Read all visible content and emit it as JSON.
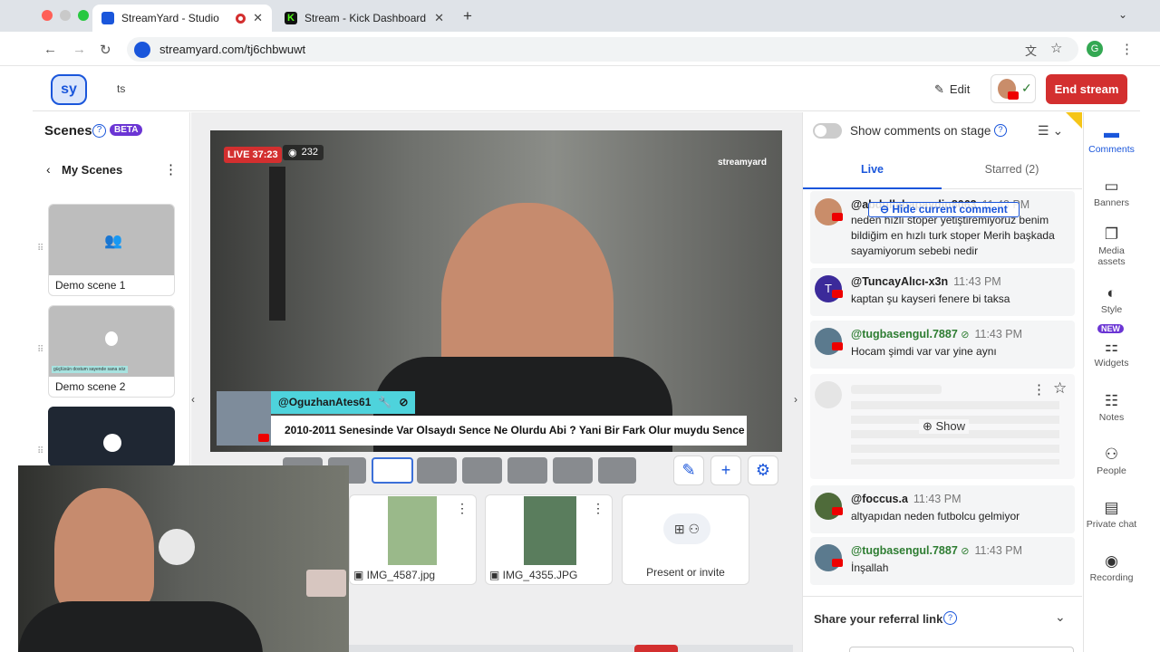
{
  "browser": {
    "tabs": [
      {
        "title": "StreamYard - Studio",
        "fav_color": "#1a56db"
      },
      {
        "title": "Stream - Kick Dashboard",
        "fav_color": "#53fc18"
      }
    ],
    "new_tab": "+",
    "url": "streamyard.com/tj6chbwuwt",
    "profile": "G"
  },
  "header": {
    "logo": "sy",
    "title": "ts",
    "edit": "Edit",
    "end_stream": "End stream"
  },
  "scenes": {
    "title": "Scenes",
    "beta": "BETA",
    "my_scenes": "My Scenes",
    "items": [
      {
        "label": "Demo scene 1"
      },
      {
        "label": "Demo scene 2",
        "ticker": "güçlüsün dostum sayende sana söz"
      }
    ]
  },
  "stage": {
    "live_badge": "LIVE 37:23",
    "viewers": "232",
    "watermark": "streamyard",
    "banner_user": "@OguzhanAtes61",
    "banner_text": "2010-2011 Senesinde Var Olsaydı Sence Ne Olurdu Abi ? Yani Bir Fark Olur muydu Sence ?"
  },
  "media": [
    {
      "name": "IMG_4587.jpg"
    },
    {
      "name": "IMG_4355.JPG"
    },
    {
      "name": "Present or invite"
    }
  ],
  "comments_panel": {
    "toggle_label": "Show comments on stage",
    "tab_live": "Live",
    "tab_starred": "Starred (2)",
    "hide_comment": "Hide current comment",
    "show": "Show",
    "comments": [
      {
        "name": "@abdullahapaydin8063",
        "time": "11:43 PM",
        "text": "neden hızlı stoper yetiştiremiyoruz benim bildiğim en hızlı turk stoper Merih başkada sayamiyorum sebebi nedir",
        "color": "#1f1f1f"
      },
      {
        "name": "@TuncayAlıcı-x3n",
        "time": "11:43 PM",
        "text": "kaptan şu kayseri fenere bi taksa",
        "color": "#1f1f1f"
      },
      {
        "name": "@tugbasengul.7887",
        "time": "11:43 PM",
        "text": "Hocam şimdi var var yine aynı",
        "color": "#2e7d32"
      },
      {
        "name": "@foccus.a",
        "time": "11:43 PM",
        "text": "altyapıdan neden futbolcu gelmiyor",
        "color": "#1f1f1f"
      },
      {
        "name": "@tugbasengul.7887",
        "time": "11:43 PM",
        "text": "İnşallah",
        "color": "#2e7d32"
      }
    ],
    "referral": "Share your referral link"
  },
  "rail": [
    {
      "label": "Comments",
      "icon": "comment-icon"
    },
    {
      "label": "Banners",
      "icon": "banner-icon"
    },
    {
      "label": "Media assets",
      "icon": "media-icon"
    },
    {
      "label": "Style",
      "icon": "palette-icon"
    },
    {
      "label": "Widgets",
      "icon": "widgets-icon",
      "badge": "NEW"
    },
    {
      "label": "Notes",
      "icon": "notes-icon"
    },
    {
      "label": "People",
      "icon": "people-icon"
    },
    {
      "label": "Private chat",
      "icon": "chat-icon"
    },
    {
      "label": "Recording",
      "icon": "record-icon"
    }
  ]
}
